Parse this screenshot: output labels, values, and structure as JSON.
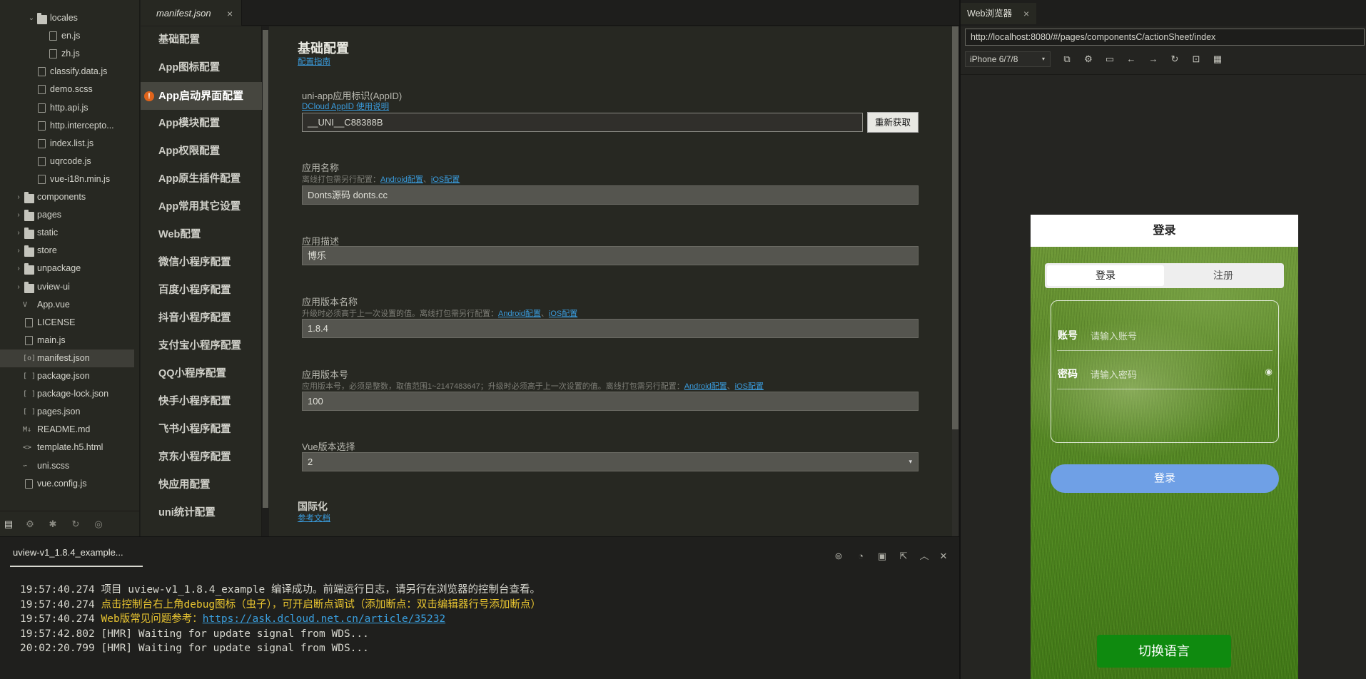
{
  "tree": {
    "items": [
      {
        "label": "locales",
        "kind": "folder",
        "expanded": true,
        "depth": 2
      },
      {
        "label": "en.js",
        "kind": "file",
        "depth": 3
      },
      {
        "label": "zh.js",
        "kind": "file",
        "depth": 3
      },
      {
        "label": "classify.data.js",
        "kind": "file",
        "depth": 2
      },
      {
        "label": "demo.scss",
        "kind": "file",
        "depth": 2
      },
      {
        "label": "http.api.js",
        "kind": "file",
        "depth": 2
      },
      {
        "label": "http.intercepto...",
        "kind": "file",
        "depth": 2
      },
      {
        "label": "index.list.js",
        "kind": "file",
        "depth": 2
      },
      {
        "label": "uqrcode.js",
        "kind": "file",
        "depth": 2
      },
      {
        "label": "vue-i18n.min.js",
        "kind": "file",
        "depth": 2
      },
      {
        "label": "components",
        "kind": "folder",
        "expanded": false,
        "depth": 1
      },
      {
        "label": "pages",
        "kind": "folder",
        "expanded": false,
        "depth": 1
      },
      {
        "label": "static",
        "kind": "folder",
        "expanded": false,
        "depth": 1
      },
      {
        "label": "store",
        "kind": "folder",
        "expanded": false,
        "depth": 1
      },
      {
        "label": "unpackage",
        "kind": "folder",
        "expanded": false,
        "depth": 1
      },
      {
        "label": "uview-ui",
        "kind": "folder",
        "expanded": false,
        "depth": 1
      },
      {
        "label": "App.vue",
        "kind": "vue",
        "badge": "V",
        "depth": 1
      },
      {
        "label": "LICENSE",
        "kind": "file",
        "depth": 1
      },
      {
        "label": "main.js",
        "kind": "file",
        "depth": 1
      },
      {
        "label": "manifest.json",
        "kind": "json",
        "badge": "[o]",
        "depth": 1,
        "selected": true
      },
      {
        "label": "package.json",
        "kind": "json",
        "badge": "[ ]",
        "depth": 1
      },
      {
        "label": "package-lock.json",
        "kind": "json",
        "badge": "[ ]",
        "depth": 1
      },
      {
        "label": "pages.json",
        "kind": "json",
        "badge": "[ ]",
        "depth": 1
      },
      {
        "label": "README.md",
        "kind": "md",
        "badge": "M↓",
        "depth": 1
      },
      {
        "label": "template.h5.html",
        "kind": "html",
        "badge": "<>",
        "depth": 1
      },
      {
        "label": "uni.scss",
        "kind": "scss",
        "badge": "∽",
        "depth": 1
      },
      {
        "label": "vue.config.js",
        "kind": "file",
        "depth": 1
      }
    ],
    "bottom_icons": [
      "file-tree-icon",
      "plugin-icon",
      "debug-icon",
      "source-control-icon",
      "browser-icon"
    ]
  },
  "editor": {
    "tab_label": "manifest.json",
    "tab_close": "×"
  },
  "settings_nav": {
    "items": [
      "基础配置",
      "App图标配置",
      "App启动界面配置",
      "App模块配置",
      "App权限配置",
      "App原生插件配置",
      "App常用其它设置",
      "Web配置",
      "微信小程序配置",
      "百度小程序配置",
      "抖音小程序配置",
      "支付宝小程序配置",
      "QQ小程序配置",
      "快手小程序配置",
      "飞书小程序配置",
      "京东小程序配置",
      "快应用配置",
      "uni统计配置"
    ],
    "active_index": 2,
    "warning_mark": "!"
  },
  "form": {
    "title": "基础配置",
    "guide_link": "配置指南",
    "appid": {
      "label": "uni-app应用标识(AppID)",
      "help_link": "DCloud AppID 使用说明",
      "value": "__UNI__C88388B",
      "refresh_button": "重新获取"
    },
    "app_name": {
      "label": "应用名称",
      "hint": "离线打包需另行配置：",
      "android_link": "Android配置",
      "sep": "、",
      "ios_link": "iOS配置",
      "value": "Donts源码 donts.cc"
    },
    "app_desc": {
      "label": "应用描述",
      "value": "博乐"
    },
    "version_name": {
      "label": "应用版本名称",
      "hint": "升级时必须高于上一次设置的值。离线打包需另行配置：",
      "android_link": "Android配置",
      "sep": "、",
      "ios_link": "iOS配置",
      "value": "1.8.4"
    },
    "version_code": {
      "label": "应用版本号",
      "hint": "应用版本号，必须是整数，取值范围1~2147483647；升级时必须高于上一次设置的值。离线打包需另行配置：",
      "android_link": "Android配置",
      "sep": "、",
      "ios_link": "iOS配置",
      "value": "100"
    },
    "vue_version": {
      "label": "Vue版本选择",
      "value": "2",
      "arrow": "▾"
    },
    "i18n": {
      "title": "国际化",
      "link": "参考文档"
    }
  },
  "console": {
    "tab_label": "uview-v1_1.8.4_example...",
    "tool_icons": [
      "clear-icon",
      "stop-icon",
      "restore-icon",
      "export-icon",
      "collapse-up-icon",
      "close-x-icon"
    ],
    "lines": [
      {
        "ts": "19:57:40.274",
        "msg": "项目 uview-v1_1.8.4_example 编译成功。前端运行日志，请另行在浏览器的控制台查看。",
        "color": "normal"
      },
      {
        "ts": "19:57:40.274",
        "msg": "点击控制台右上角debug图标（虫子），可开启断点调试（添加断点：双击编辑器行号添加断点）",
        "color": "yellow"
      },
      {
        "ts": "19:57:40.274",
        "msg": "Web版常见问题参考：",
        "link": "https://ask.dcloud.net.cn/article/35232",
        "color": "yellow"
      },
      {
        "ts": "19:57:42.802",
        "msg": "[HMR] Waiting for update signal from WDS...",
        "color": "normal"
      },
      {
        "ts": "20:02:20.799",
        "msg": "[HMR] Waiting for update signal from WDS...",
        "color": "normal"
      }
    ]
  },
  "preview": {
    "tab_label": "Web浏览器",
    "tab_close": "×",
    "url": "http://localhost:8080/#/pages/componentsC/actionSheet/index",
    "device": "iPhone 6/7/8",
    "device_arrow": "▾",
    "toolbar_icons": [
      "screenshot-icon",
      "settings-icon",
      "console-icon",
      "back-icon",
      "forward-icon",
      "reload-icon",
      "lock-icon",
      "qrcode-icon"
    ],
    "phone": {
      "nav_title": "登录",
      "seg_login": "登录",
      "seg_register": "注册",
      "account_label": "账号",
      "account_placeholder": "请输入账号",
      "password_label": "密码",
      "password_placeholder": "请输入密码",
      "login_button": "登录",
      "switch_lang_button": "切换语言"
    }
  },
  "colors": {
    "accent_link": "#3a9bdc",
    "warning": "#e0641b",
    "console_yellow": "#e8c430",
    "login_button": "#6fa0e6",
    "lang_button": "#0f8a0f"
  }
}
